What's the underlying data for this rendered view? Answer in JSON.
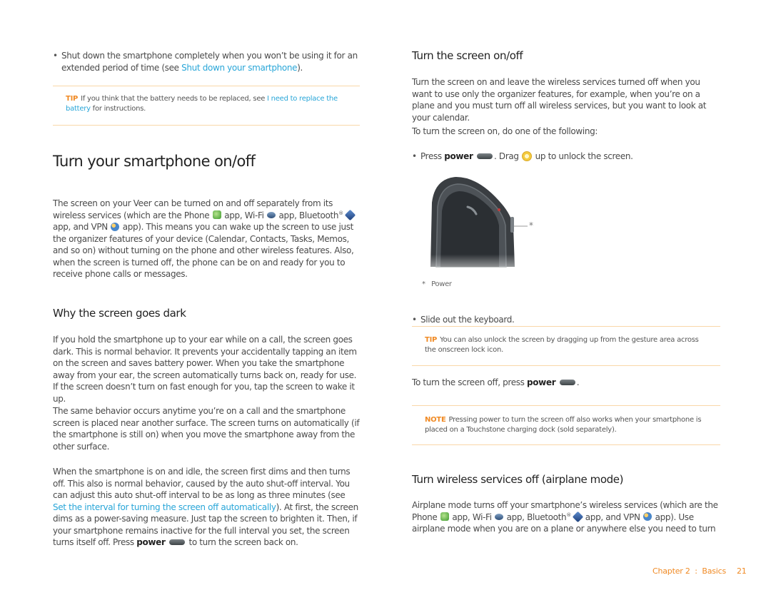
{
  "left_column": {
    "intro_bullet": {
      "text_before": "Shut down the smartphone completely when you won’t be using it for an extended period of time (see ",
      "link": "Shut down your smartphone",
      "text_after": ")."
    },
    "tip_1": {
      "label": "TIP",
      "text_before": "If you think that the battery needs to be replaced, see ",
      "link": "I need to replace the battery",
      "text_after": " for instructions."
    },
    "section_title": "Turn your smartphone on/off",
    "intro_paragraph": {
      "part1": "The screen on your Veer can be turned on and off separately from its wireless services (which are the Phone ",
      "part2": " app, Wi-Fi ",
      "part3": " app, Bluetooth",
      "registered": "®",
      "part4": " app, and VPN ",
      "part5": " app). This means you can wake up the screen to use just the organizer features of your device (Calendar, Contacts, Tasks, Memos, and so on) without turning on the phone and other wireless features. Also, when the screen is turned off, the phone can be on and ready for you to receive phone calls or messages."
    },
    "subsection_title": "Why the screen goes dark",
    "paragraph_dark_1": "If you hold the smartphone up to your ear while on a call, the screen goes dark. This is normal behavior. It prevents your accidentally tapping an item on the screen and saves battery power. When you take the smartphone away from your ear, the screen automatically turns back on, ready for use. If the screen doesn’t turn on fast enough for you, tap the screen to wake it up.",
    "paragraph_dark_2": "The same behavior occurs anytime you’re on a call and the smartphone screen is placed near another surface. The screen turns on automatically (if the smartphone is still on) when you move the smartphone away from the other surface.",
    "paragraph_dark_3": {
      "text_before": "When the smartphone is on and idle, the screen first dims and then turns off. This also is normal behavior, caused by the auto shut-off interval. You can adjust this auto shut-off interval to be as long as three minutes (see ",
      "link": "Set the interval for turning the screen off automatically",
      "text_middle": "). At first, the screen dims as a power-saving measure. Just tap the screen to brighten it. Then, if your smartphone remains inactive for the full interval you set, the screen turns itself off. Press ",
      "bold": "power",
      "text_after": " to turn the screen back on."
    }
  },
  "right_column": {
    "section_title": "Turn the screen on/off",
    "paragraph_1": "Turn the screen on and leave the wireless services turned off when you want to use only the organizer features, for example, when you’re on a plane and you must turn off all wireless services, but you want to look at your calendar.",
    "paragraph_2": "To turn the screen on, do one of the following:",
    "bullet_press": {
      "text_before": "Press ",
      "bold": "power",
      "text_middle": ". Drag ",
      "text_after": " up to unlock the screen."
    },
    "figure": {
      "callout_marker": "*",
      "caption_marker": "*",
      "caption": "Power"
    },
    "bullet_slide": "Slide out the keyboard.",
    "tip_2": {
      "label": "TIP",
      "text": "You can also unlock the screen by dragging up from the gesture area across the onscreen lock icon."
    },
    "turn_off": {
      "text_before": "To turn the screen off, press ",
      "bold": "power",
      "text_after": "."
    },
    "note": {
      "label": "NOTE",
      "text": "Pressing power to turn the screen off also works when your smartphone is placed on a Touchstone charging dock (sold separately)."
    },
    "subsection_title": "Turn wireless services off (airplane mode)",
    "airplane_paragraph": {
      "part1": "Airplane mode turns off your smartphone’s wireless services (which are the Phone ",
      "part2": " app, Wi-Fi ",
      "part3": " app, Bluetooth",
      "registered": "®",
      "part4": " app, and VPN ",
      "part5": " app). Use airplane mode when you are on a plane or anywhere else you need to turn"
    }
  },
  "footer": {
    "chapter": "Chapter 2  :  Basics",
    "page_number": "21"
  },
  "colors": {
    "link": "#29a6d8",
    "accent_orange": "#f08a24",
    "callout_rule": "#f9d7a8",
    "body_text": "#4a4a4a",
    "heading_text": "#222222"
  }
}
